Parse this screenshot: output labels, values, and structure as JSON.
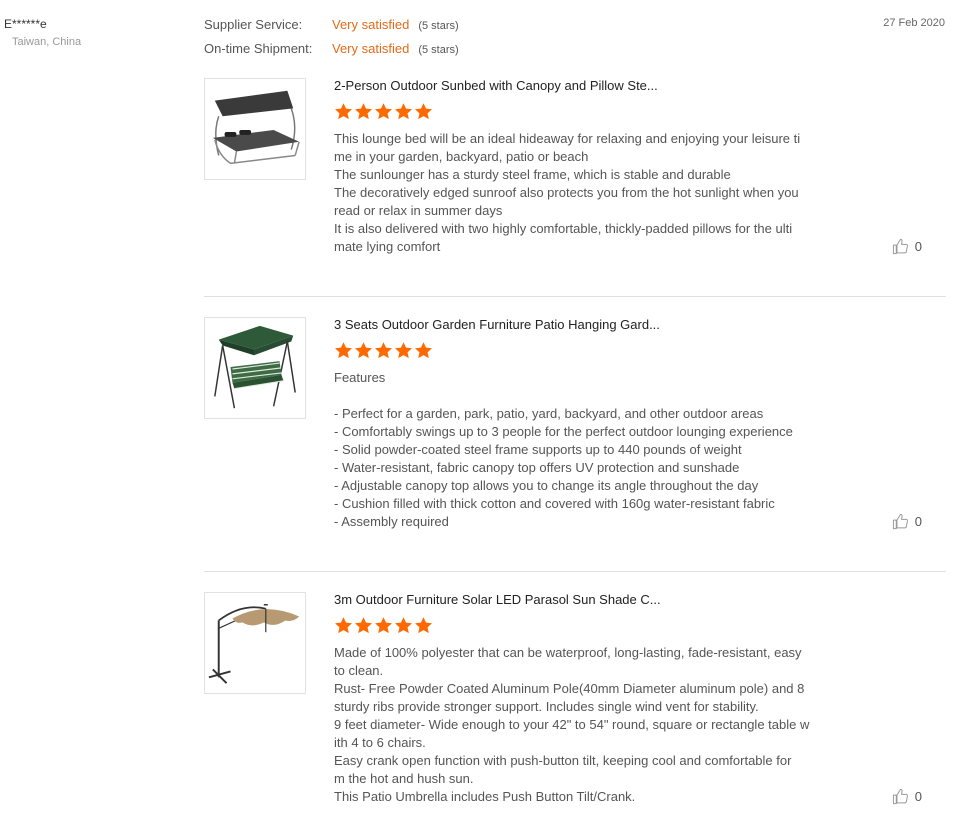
{
  "reviewer": {
    "name": "E******e",
    "location": "Taiwan, China"
  },
  "ratings": [
    {
      "label": "Supplier Service:",
      "value": "Very satisfied",
      "stars_text": "(5 stars)"
    },
    {
      "label": "On-time Shipment:",
      "value": "Very satisfied",
      "stars_text": "(5 stars)"
    }
  ],
  "date": "27 Feb 2020",
  "accent_color": "#ff6a00",
  "items": [
    {
      "title": "2-Person Outdoor Sunbed with Canopy and Pillow Ste...",
      "thumbnail_icon": "sunbed-product-image",
      "stars": 5,
      "lines": [
        "This lounge bed will be an ideal hideaway for relaxing and enjoying your leisure ti",
        "me in your garden, backyard, patio or beach",
        "The sunlounger has a sturdy steel frame, which is stable and durable",
        "The decoratively edged sunroof also protects you from the hot sunlight when you",
        "read or relax in summer days",
        "It is also delivered with two highly comfortable, thickly-padded pillows for the ulti",
        "mate lying comfort"
      ],
      "likes": "0"
    },
    {
      "title": "3 Seats Outdoor Garden Furniture Patio Hanging Gard...",
      "thumbnail_icon": "swing-product-image",
      "stars": 5,
      "lines": [
        "Features",
        "",
        "- Perfect for a garden, park, patio, yard, backyard, and other outdoor areas",
        "- Comfortably swings up to 3 people for the perfect outdoor lounging experience",
        "- Solid powder-coated steel frame supports up to 440 pounds of weight",
        "- Water-resistant, fabric canopy top offers UV protection and sunshade",
        "- Adjustable canopy top allows you to change its angle throughout the day",
        "- Cushion filled with thick cotton and covered with 160g water-resistant fabric",
        "- Assembly required"
      ],
      "likes": "0"
    },
    {
      "title": "3m Outdoor Furniture Solar LED Parasol Sun Shade C...",
      "thumbnail_icon": "parasol-product-image",
      "stars": 5,
      "lines": [
        "Made of 100% polyester that can be waterproof, long-lasting, fade-resistant, easy",
        "to clean.",
        "Rust- Free Powder Coated Aluminum Pole(40mm Diameter aluminum pole) and 8",
        "sturdy ribs provide stronger support. Includes single wind vent for stability.",
        "9 feet diameter- Wide enough to your 42\" to 54\" round, square or rectangle table w",
        "ith 4 to 6 chairs.",
        "Easy crank open function with push-button tilt, keeping cool and comfortable for",
        "m the hot and hush sun.",
        "This Patio Umbrella includes Push Button Tilt/Crank."
      ],
      "likes": "0"
    }
  ]
}
